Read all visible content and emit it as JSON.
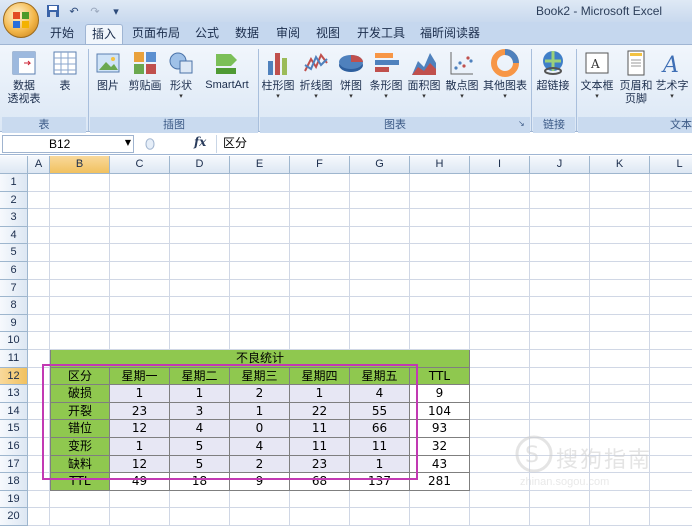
{
  "window": {
    "title": "Book2 - Microsoft Excel"
  },
  "qat": {
    "save_icon": "save-icon",
    "undo_icon": "undo-icon",
    "redo_icon": "redo-icon",
    "customize_icon": "customize-icon"
  },
  "tabs": [
    {
      "label": "开始"
    },
    {
      "label": "插入",
      "active": true
    },
    {
      "label": "页面布局"
    },
    {
      "label": "公式"
    },
    {
      "label": "数据"
    },
    {
      "label": "审阅"
    },
    {
      "label": "视图"
    },
    {
      "label": "开发工具"
    },
    {
      "label": "福昕阅读器"
    }
  ],
  "ribbon": {
    "groups": {
      "table": "表",
      "illustrations": "插图",
      "charts": "图表",
      "links": "链接",
      "text": "文本"
    },
    "buttons": {
      "pivot_line1": "数据",
      "pivot_line2": "透视表",
      "table": "表",
      "picture": "图片",
      "clipart": "剪贴画",
      "shapes": "形状",
      "smartart": "SmartArt",
      "column": "柱形图",
      "line": "折线图",
      "pie": "饼图",
      "bar": "条形图",
      "area": "面积图",
      "scatter": "散点图",
      "other": "其他图表",
      "hyperlink": "超链接",
      "textbox": "文本框",
      "header_line1": "页眉和",
      "header_line2": "页脚",
      "wordart": "艺术字"
    }
  },
  "formula_bar": {
    "name_box": "B12",
    "fx": "fx",
    "content": "区分"
  },
  "columns": [
    "A",
    "B",
    "C",
    "D",
    "E",
    "F",
    "G",
    "H",
    "I",
    "J",
    "K",
    "L"
  ],
  "rows": [
    "1",
    "2",
    "3",
    "4",
    "5",
    "6",
    "7",
    "8",
    "9",
    "10",
    "11",
    "12",
    "13",
    "14",
    "15",
    "16",
    "17",
    "18",
    "19",
    "20"
  ],
  "sheet": {
    "title": "不良统计",
    "headers": [
      "区分",
      "星期一",
      "星期二",
      "星期三",
      "星期四",
      "星期五",
      "TTL"
    ],
    "body": [
      [
        "破损",
        "1",
        "1",
        "2",
        "1",
        "4",
        "9"
      ],
      [
        "开裂",
        "23",
        "3",
        "1",
        "22",
        "55",
        "104"
      ],
      [
        "错位",
        "12",
        "4",
        "0",
        "11",
        "66",
        "93"
      ],
      [
        "变形",
        "1",
        "5",
        "4",
        "11",
        "11",
        "32"
      ],
      [
        "缺料",
        "12",
        "5",
        "2",
        "23",
        "1",
        "43"
      ]
    ],
    "total": [
      "TTL",
      "49",
      "18",
      "9",
      "68",
      "137",
      "281"
    ]
  },
  "watermark": {
    "text": "搜狗指南",
    "url": "zhinan.sogou.com"
  }
}
